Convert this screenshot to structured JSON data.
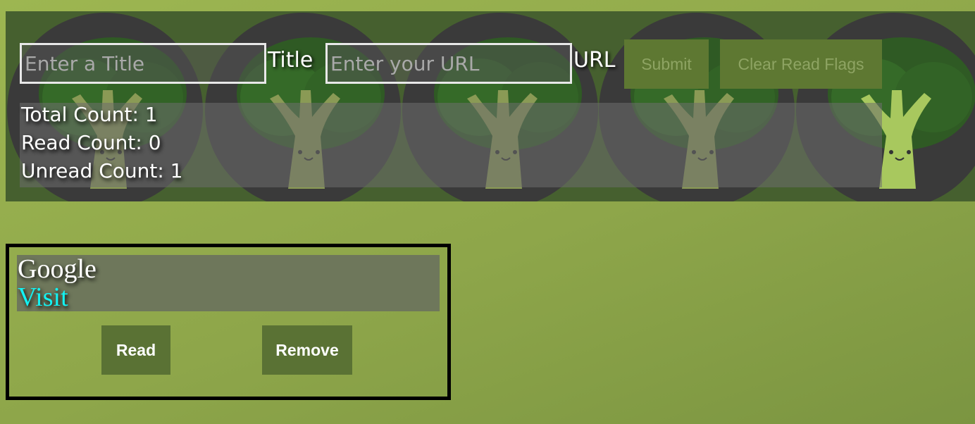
{
  "header": {
    "title_input": {
      "placeholder": "Enter a Title",
      "value": ""
    },
    "title_label": "Title",
    "url_input": {
      "placeholder": "Enter your URL",
      "value": ""
    },
    "url_label": "URL",
    "submit_label": "Submit",
    "clear_label": "Clear Read Flags",
    "background_icon": "broccoli-icon"
  },
  "stats": {
    "total": "Total Count: 1",
    "read": "Read Count: 0",
    "unread": "Unread Count: 1"
  },
  "bookmarks": [
    {
      "title": "Google",
      "link_label": "Visit",
      "read_label": "Read",
      "remove_label": "Remove"
    }
  ],
  "colors": {
    "page_bg": "#94ad4d",
    "header_bg": "#46602f",
    "circle_bg": "#3a3a3a",
    "button_bg": "#5e7832",
    "link": "#13f2f2"
  }
}
